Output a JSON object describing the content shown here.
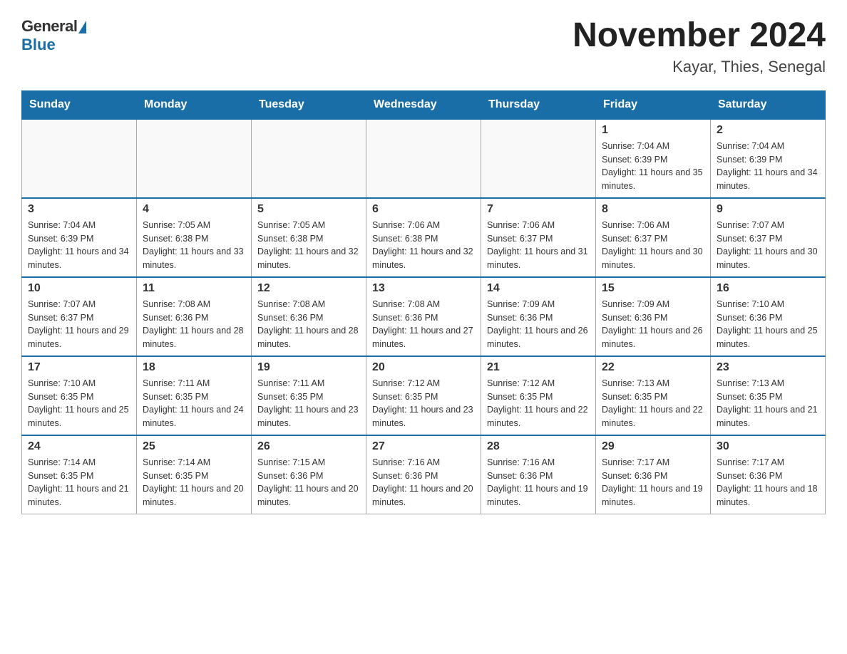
{
  "logo": {
    "general": "General",
    "blue": "Blue"
  },
  "header": {
    "month": "November 2024",
    "location": "Kayar, Thies, Senegal"
  },
  "days_of_week": [
    "Sunday",
    "Monday",
    "Tuesday",
    "Wednesday",
    "Thursday",
    "Friday",
    "Saturday"
  ],
  "weeks": [
    [
      {
        "day": "",
        "sunrise": "",
        "sunset": "",
        "daylight": ""
      },
      {
        "day": "",
        "sunrise": "",
        "sunset": "",
        "daylight": ""
      },
      {
        "day": "",
        "sunrise": "",
        "sunset": "",
        "daylight": ""
      },
      {
        "day": "",
        "sunrise": "",
        "sunset": "",
        "daylight": ""
      },
      {
        "day": "",
        "sunrise": "",
        "sunset": "",
        "daylight": ""
      },
      {
        "day": "1",
        "sunrise": "Sunrise: 7:04 AM",
        "sunset": "Sunset: 6:39 PM",
        "daylight": "Daylight: 11 hours and 35 minutes."
      },
      {
        "day": "2",
        "sunrise": "Sunrise: 7:04 AM",
        "sunset": "Sunset: 6:39 PM",
        "daylight": "Daylight: 11 hours and 34 minutes."
      }
    ],
    [
      {
        "day": "3",
        "sunrise": "Sunrise: 7:04 AM",
        "sunset": "Sunset: 6:39 PM",
        "daylight": "Daylight: 11 hours and 34 minutes."
      },
      {
        "day": "4",
        "sunrise": "Sunrise: 7:05 AM",
        "sunset": "Sunset: 6:38 PM",
        "daylight": "Daylight: 11 hours and 33 minutes."
      },
      {
        "day": "5",
        "sunrise": "Sunrise: 7:05 AM",
        "sunset": "Sunset: 6:38 PM",
        "daylight": "Daylight: 11 hours and 32 minutes."
      },
      {
        "day": "6",
        "sunrise": "Sunrise: 7:06 AM",
        "sunset": "Sunset: 6:38 PM",
        "daylight": "Daylight: 11 hours and 32 minutes."
      },
      {
        "day": "7",
        "sunrise": "Sunrise: 7:06 AM",
        "sunset": "Sunset: 6:37 PM",
        "daylight": "Daylight: 11 hours and 31 minutes."
      },
      {
        "day": "8",
        "sunrise": "Sunrise: 7:06 AM",
        "sunset": "Sunset: 6:37 PM",
        "daylight": "Daylight: 11 hours and 30 minutes."
      },
      {
        "day": "9",
        "sunrise": "Sunrise: 7:07 AM",
        "sunset": "Sunset: 6:37 PM",
        "daylight": "Daylight: 11 hours and 30 minutes."
      }
    ],
    [
      {
        "day": "10",
        "sunrise": "Sunrise: 7:07 AM",
        "sunset": "Sunset: 6:37 PM",
        "daylight": "Daylight: 11 hours and 29 minutes."
      },
      {
        "day": "11",
        "sunrise": "Sunrise: 7:08 AM",
        "sunset": "Sunset: 6:36 PM",
        "daylight": "Daylight: 11 hours and 28 minutes."
      },
      {
        "day": "12",
        "sunrise": "Sunrise: 7:08 AM",
        "sunset": "Sunset: 6:36 PM",
        "daylight": "Daylight: 11 hours and 28 minutes."
      },
      {
        "day": "13",
        "sunrise": "Sunrise: 7:08 AM",
        "sunset": "Sunset: 6:36 PM",
        "daylight": "Daylight: 11 hours and 27 minutes."
      },
      {
        "day": "14",
        "sunrise": "Sunrise: 7:09 AM",
        "sunset": "Sunset: 6:36 PM",
        "daylight": "Daylight: 11 hours and 26 minutes."
      },
      {
        "day": "15",
        "sunrise": "Sunrise: 7:09 AM",
        "sunset": "Sunset: 6:36 PM",
        "daylight": "Daylight: 11 hours and 26 minutes."
      },
      {
        "day": "16",
        "sunrise": "Sunrise: 7:10 AM",
        "sunset": "Sunset: 6:36 PM",
        "daylight": "Daylight: 11 hours and 25 minutes."
      }
    ],
    [
      {
        "day": "17",
        "sunrise": "Sunrise: 7:10 AM",
        "sunset": "Sunset: 6:35 PM",
        "daylight": "Daylight: 11 hours and 25 minutes."
      },
      {
        "day": "18",
        "sunrise": "Sunrise: 7:11 AM",
        "sunset": "Sunset: 6:35 PM",
        "daylight": "Daylight: 11 hours and 24 minutes."
      },
      {
        "day": "19",
        "sunrise": "Sunrise: 7:11 AM",
        "sunset": "Sunset: 6:35 PM",
        "daylight": "Daylight: 11 hours and 23 minutes."
      },
      {
        "day": "20",
        "sunrise": "Sunrise: 7:12 AM",
        "sunset": "Sunset: 6:35 PM",
        "daylight": "Daylight: 11 hours and 23 minutes."
      },
      {
        "day": "21",
        "sunrise": "Sunrise: 7:12 AM",
        "sunset": "Sunset: 6:35 PM",
        "daylight": "Daylight: 11 hours and 22 minutes."
      },
      {
        "day": "22",
        "sunrise": "Sunrise: 7:13 AM",
        "sunset": "Sunset: 6:35 PM",
        "daylight": "Daylight: 11 hours and 22 minutes."
      },
      {
        "day": "23",
        "sunrise": "Sunrise: 7:13 AM",
        "sunset": "Sunset: 6:35 PM",
        "daylight": "Daylight: 11 hours and 21 minutes."
      }
    ],
    [
      {
        "day": "24",
        "sunrise": "Sunrise: 7:14 AM",
        "sunset": "Sunset: 6:35 PM",
        "daylight": "Daylight: 11 hours and 21 minutes."
      },
      {
        "day": "25",
        "sunrise": "Sunrise: 7:14 AM",
        "sunset": "Sunset: 6:35 PM",
        "daylight": "Daylight: 11 hours and 20 minutes."
      },
      {
        "day": "26",
        "sunrise": "Sunrise: 7:15 AM",
        "sunset": "Sunset: 6:36 PM",
        "daylight": "Daylight: 11 hours and 20 minutes."
      },
      {
        "day": "27",
        "sunrise": "Sunrise: 7:16 AM",
        "sunset": "Sunset: 6:36 PM",
        "daylight": "Daylight: 11 hours and 20 minutes."
      },
      {
        "day": "28",
        "sunrise": "Sunrise: 7:16 AM",
        "sunset": "Sunset: 6:36 PM",
        "daylight": "Daylight: 11 hours and 19 minutes."
      },
      {
        "day": "29",
        "sunrise": "Sunrise: 7:17 AM",
        "sunset": "Sunset: 6:36 PM",
        "daylight": "Daylight: 11 hours and 19 minutes."
      },
      {
        "day": "30",
        "sunrise": "Sunrise: 7:17 AM",
        "sunset": "Sunset: 6:36 PM",
        "daylight": "Daylight: 11 hours and 18 minutes."
      }
    ]
  ]
}
